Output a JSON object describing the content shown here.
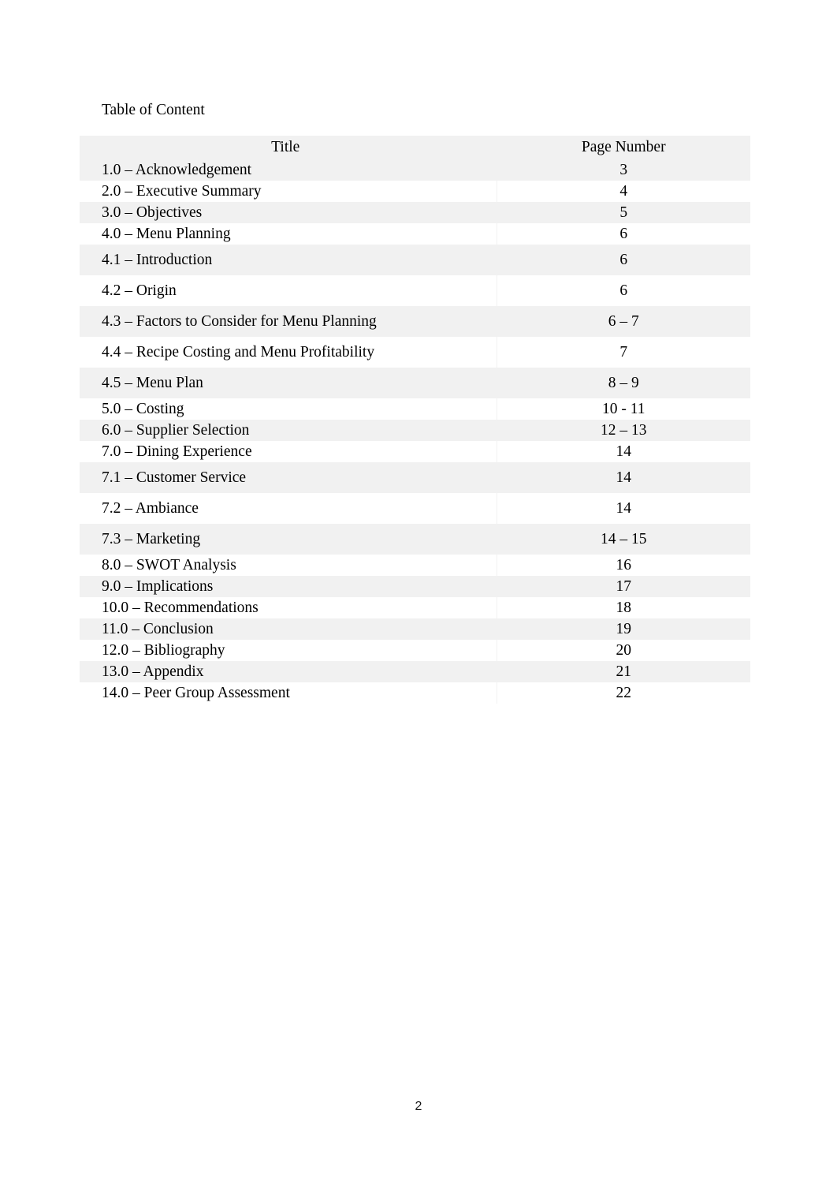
{
  "document": {
    "heading": "Table of Content",
    "footer_page_number": "2"
  },
  "toc_table": {
    "columns": [
      "Title",
      "Page Number"
    ],
    "rows": [
      {
        "title": "1.0 – Acknowledgement",
        "page": "3",
        "spacing": "tight"
      },
      {
        "title": "2.0 – Executive Summary",
        "page": "4",
        "spacing": "tight"
      },
      {
        "title": "3.0 – Objectives",
        "page": "5",
        "spacing": "tight"
      },
      {
        "title": "4.0 – Menu Planning",
        "page": "6",
        "spacing": "tight"
      },
      {
        "title": "4.1 – Introduction",
        "page": "6",
        "spacing": "loose"
      },
      {
        "title": "4.2 – Origin",
        "page": "6",
        "spacing": "loose"
      },
      {
        "title": "4.3 – Factors to Consider for Menu Planning",
        "page": "6 – 7",
        "spacing": "loose"
      },
      {
        "title": "4.4 – Recipe Costing and Menu Profitability",
        "page": "7",
        "spacing": "loose"
      },
      {
        "title": "4.5 – Menu Plan",
        "page": "8 – 9",
        "spacing": "loose"
      },
      {
        "title": "5.0 – Costing",
        "page": "10 - 11",
        "spacing": "tight"
      },
      {
        "title": "6.0 – Supplier Selection",
        "page": "12 – 13",
        "spacing": "tight"
      },
      {
        "title": "7.0 – Dining Experience",
        "page": "14",
        "spacing": "tight"
      },
      {
        "title": "7.1 – Customer Service",
        "page": "14",
        "spacing": "loose"
      },
      {
        "title": "7.2 – Ambiance",
        "page": "14",
        "spacing": "loose"
      },
      {
        "title": "7.3 – Marketing",
        "page": "14 – 15",
        "spacing": "loose"
      },
      {
        "title": "8.0 – SWOT Analysis",
        "page": "16",
        "spacing": "tight"
      },
      {
        "title": "9.0 – Implications",
        "page": "17",
        "spacing": "tight"
      },
      {
        "title": "10.0 – Recommendations",
        "page": "18",
        "spacing": "tight"
      },
      {
        "title": "11.0 – Conclusion",
        "page": "19",
        "spacing": "tight"
      },
      {
        "title": "12.0 – Bibliography",
        "page": "20",
        "spacing": "tight"
      },
      {
        "title": "13.0 – Appendix",
        "page": "21",
        "spacing": "tight"
      },
      {
        "title": "14.0 – Peer Group Assessment",
        "page": "22",
        "spacing": "tight"
      }
    ]
  },
  "colors": {
    "text": "#000000",
    "band": "#f1f1f1",
    "page_background": "#ffffff"
  }
}
